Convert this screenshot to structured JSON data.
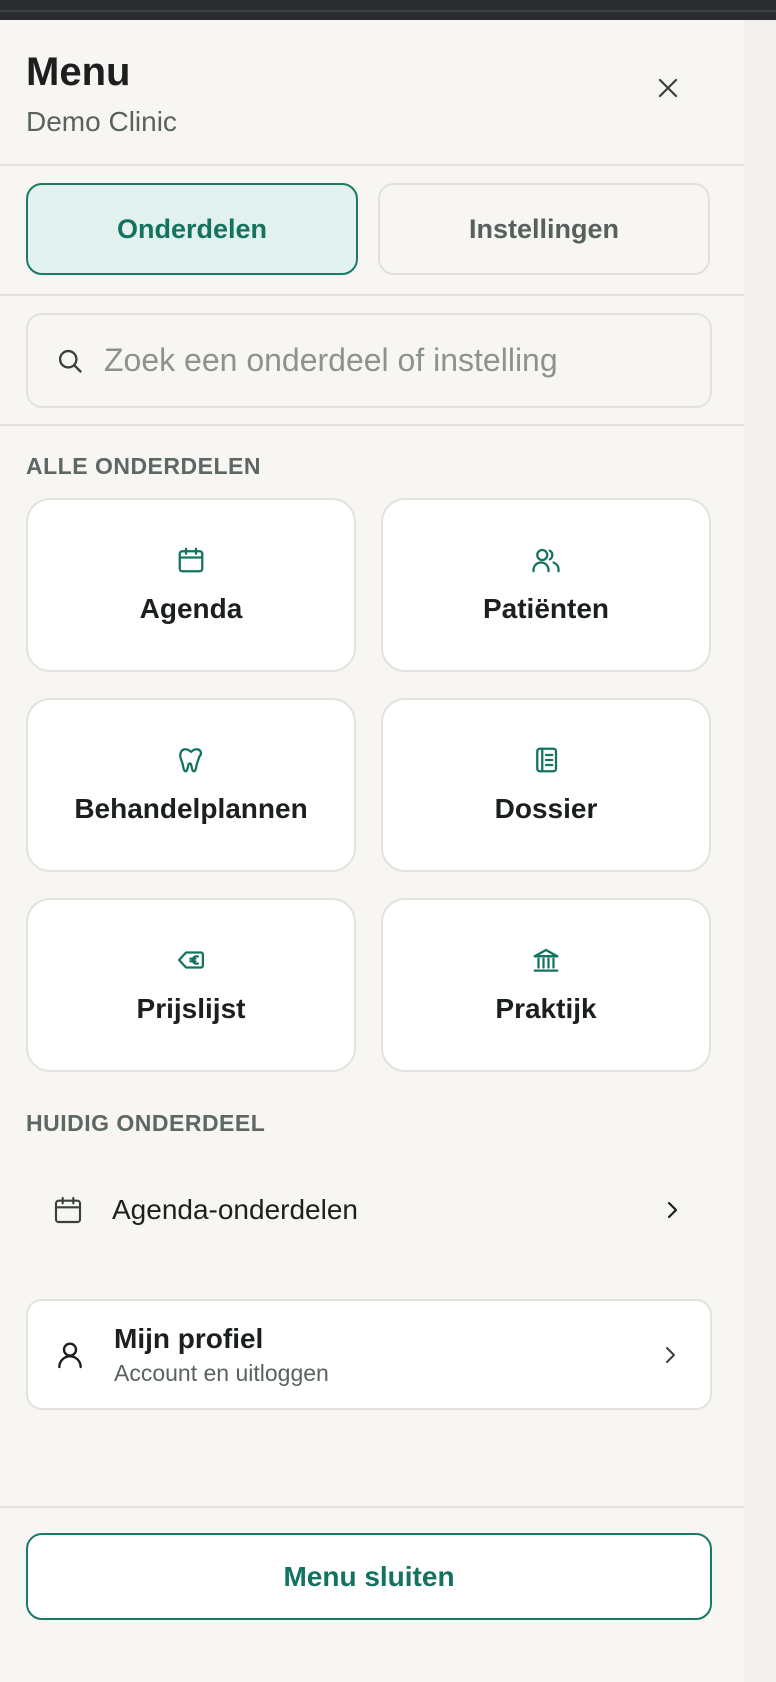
{
  "header": {
    "title": "Menu",
    "subtitle": "Demo Clinic"
  },
  "tabs": [
    {
      "label": "Onderdelen",
      "active": true
    },
    {
      "label": "Instellingen",
      "active": false
    }
  ],
  "search": {
    "placeholder": "Zoek een onderdeel of instelling",
    "value": ""
  },
  "sections": {
    "all": "ALLE ONDERDELEN",
    "current": "HUIDIG ONDERDEEL"
  },
  "modules": [
    {
      "label": "Agenda",
      "icon": "calendar-icon"
    },
    {
      "label": "Patiënten",
      "icon": "users-icon"
    },
    {
      "label": "Behandelplannen",
      "icon": "tooth-icon"
    },
    {
      "label": "Dossier",
      "icon": "notebook-icon"
    },
    {
      "label": "Prijslijst",
      "icon": "euro-tag-icon"
    },
    {
      "label": "Praktijk",
      "icon": "bank-icon"
    }
  ],
  "current": {
    "label": "Agenda-onderdelen",
    "icon": "calendar-icon"
  },
  "profile": {
    "title": "Mijn profiel",
    "subtitle": "Account en uitloggen",
    "icon": "user-icon"
  },
  "footer": {
    "close_label": "Menu sluiten"
  },
  "colors": {
    "accent": "#137360",
    "accent_bg": "#e3f1ee",
    "background": "#f7f6f2",
    "card": "#ffffff",
    "border": "#e4e2dc"
  }
}
